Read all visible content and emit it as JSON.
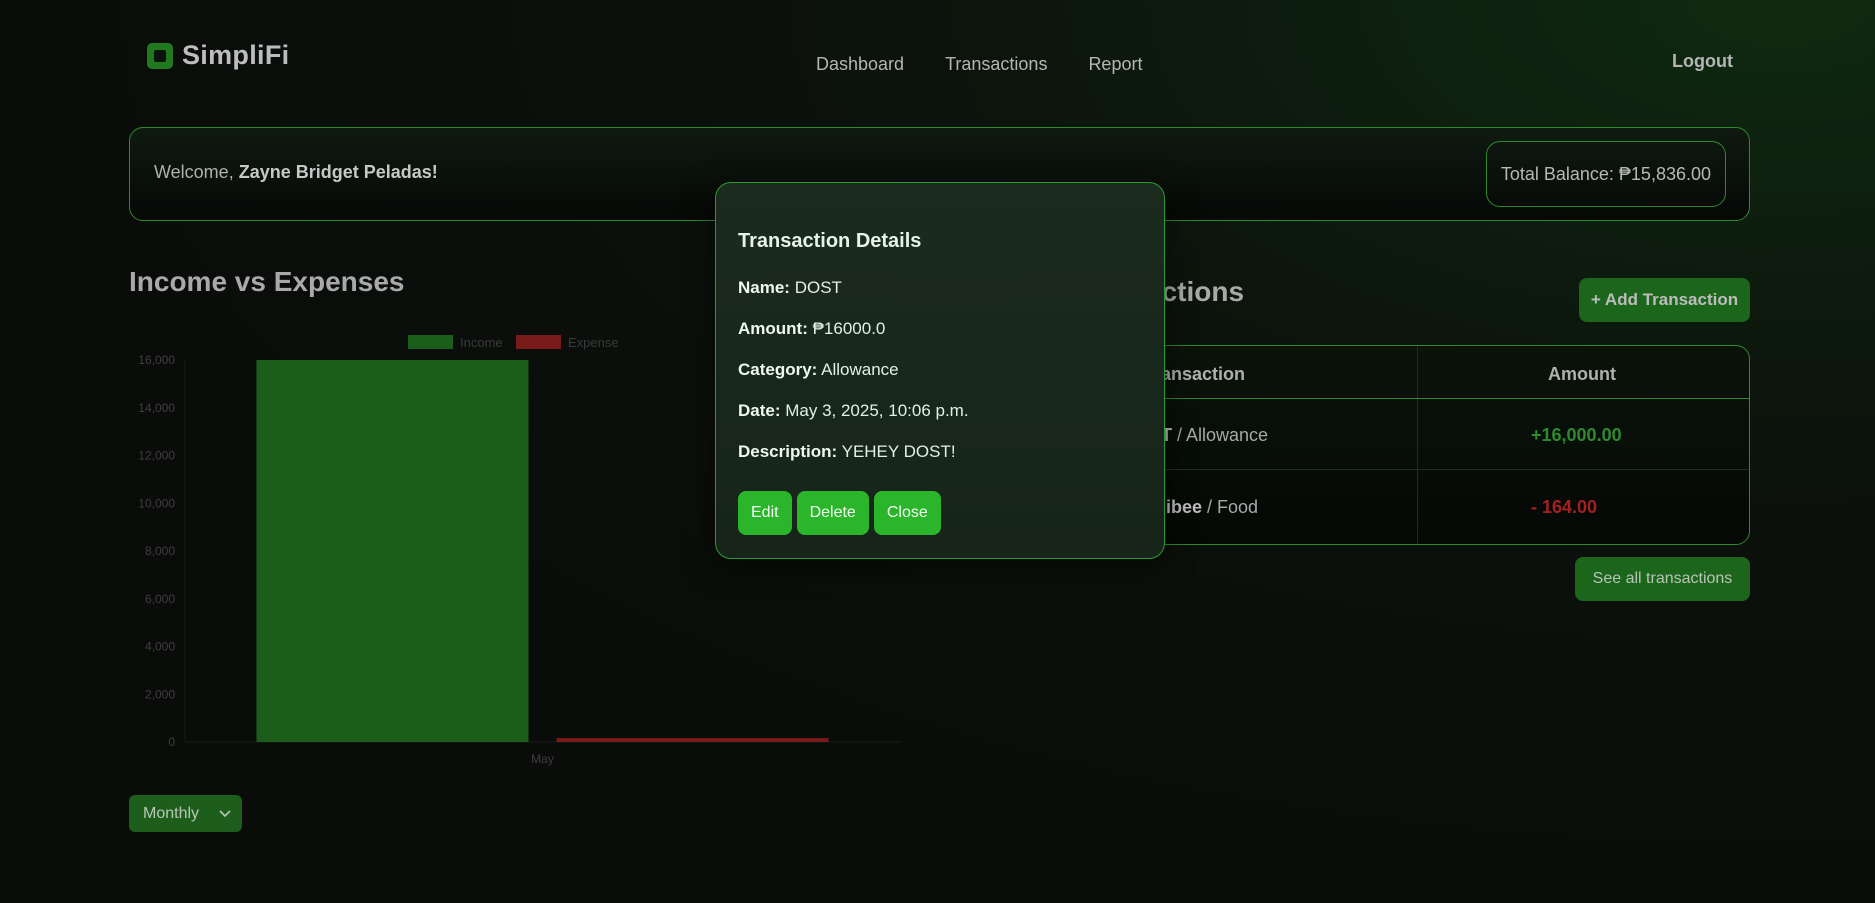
{
  "app": {
    "name": "SimpliFi"
  },
  "nav": {
    "items": [
      "Dashboard",
      "Transactions",
      "Report"
    ],
    "logout": "Logout"
  },
  "welcome": {
    "prefix": "Welcome, ",
    "user": "Zayne Bridget Peladas!",
    "balance_label": "Total Balance: ₱15,836.00"
  },
  "chart_section": {
    "title": "Income vs Expenses",
    "period": "Monthly"
  },
  "chart_data": {
    "type": "bar",
    "categories": [
      "May"
    ],
    "series": [
      {
        "name": "Income",
        "values": [
          16000
        ],
        "color": "#1b5e1b"
      },
      {
        "name": "Expense",
        "values": [
          164
        ],
        "color": "#7a1b1b"
      }
    ],
    "ylim": [
      0,
      16000
    ],
    "yticks": [
      "0",
      "2,000",
      "4,000",
      "6,000",
      "8,000",
      "10,000",
      "12,000",
      "14,000",
      "16,000"
    ],
    "legend": "top-center",
    "grid": false
  },
  "transactions": {
    "title_visible": "actions",
    "add_label": "+ Add Transaction",
    "columns": [
      "ansaction",
      "Amount"
    ],
    "rows": [
      {
        "name": "T",
        "category": " / Allowance",
        "amount": "+16,000.00",
        "type": "income"
      },
      {
        "name": "libee",
        "category": " / Food",
        "amount": "- 164.00",
        "type": "expense"
      }
    ],
    "see_all": "See all transactions"
  },
  "modal": {
    "title": "Transaction Details",
    "name_label": "Name:",
    "name_value": " DOST",
    "amount_label": "Amount:",
    "amount_value": " ₱16000.0",
    "category_label": "Category:",
    "category_value": " Allowance",
    "date_label": "Date:",
    "date_value": " May 3, 2025, 10:06 p.m.",
    "description_label": "Description:",
    "description_value": " YEHEY DOST!",
    "edit": "Edit",
    "delete": "Delete",
    "close": "Close"
  }
}
